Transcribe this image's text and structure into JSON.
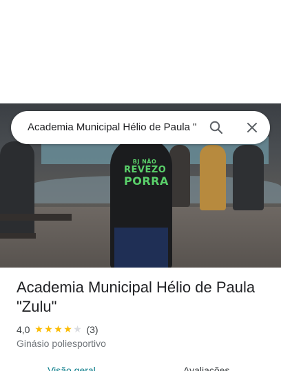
{
  "search": {
    "query": "Academia Municipal Hélio de Paula \""
  },
  "photo": {
    "shirt_text_lines": [
      "BJ NÃO",
      "REVEZO",
      "PORRA"
    ]
  },
  "place": {
    "title": "Academia Municipal Hélio de Paula \"Zulu\"",
    "rating_value": "4,0",
    "rating": 4.0,
    "rating_max": 5,
    "review_count": "(3)",
    "category": "Ginásio poliesportivo"
  },
  "tabs": [
    {
      "label": "Visão geral",
      "active": true
    },
    {
      "label": "Avaliações",
      "active": false
    }
  ],
  "colors": {
    "star": "#fbbc04",
    "accent": "#0b7d8a"
  },
  "icons": {
    "search": "search-icon",
    "close": "close-icon"
  }
}
